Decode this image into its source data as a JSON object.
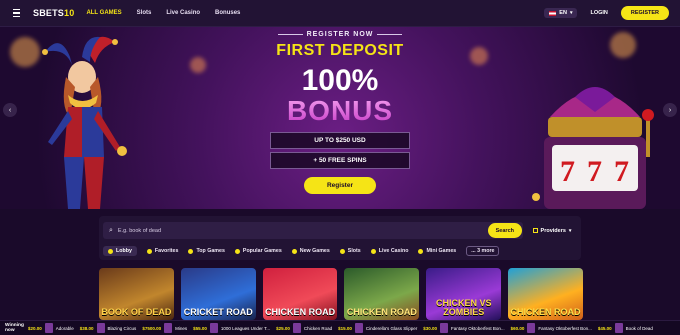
{
  "header": {
    "logo_main": "SBETS",
    "logo_accent": "10",
    "nav": [
      {
        "label": "ALL GAMES",
        "active": true
      },
      {
        "label": "Slots",
        "active": false
      },
      {
        "label": "Live Casino",
        "active": false
      },
      {
        "label": "Bonuses",
        "active": false
      }
    ],
    "language": "EN",
    "login_label": "LOGIN",
    "register_label": "REGISTER"
  },
  "hero": {
    "register_now": "REGISTER NOW",
    "first_deposit": "FIRST DEPOSIT",
    "percent": "100%",
    "bonus": "BONUS",
    "offer_1": "UP TO $250 USD",
    "offer_2": "+ 50 FREE SPINS",
    "cta_label": "Register",
    "prev_icon": "chevron-left-icon",
    "next_icon": "chevron-right-icon"
  },
  "search": {
    "placeholder": "E.g. book of dead",
    "button_label": "Search",
    "providers_label": "Providers"
  },
  "categories": [
    {
      "label": "Lobby",
      "active": true,
      "icon": "lobby-icon"
    },
    {
      "label": "Favorites",
      "active": false,
      "icon": "star-icon"
    },
    {
      "label": "Top Games",
      "active": false,
      "icon": "trophy-icon"
    },
    {
      "label": "Popular Games",
      "active": false,
      "icon": "fire-icon"
    },
    {
      "label": "New Games",
      "active": false,
      "icon": "new-icon"
    },
    {
      "label": "Slots",
      "active": false,
      "icon": "slots-icon"
    },
    {
      "label": "Live Casino",
      "active": false,
      "icon": "live-icon"
    },
    {
      "label": "Mini Games",
      "active": false,
      "icon": "mini-games-icon"
    },
    {
      "label": "... 3 more",
      "active": false,
      "icon": ""
    }
  ],
  "games": [
    {
      "title": "BOOK OF DEAD"
    },
    {
      "title": "CRICKET ROAD"
    },
    {
      "title": "CHICKEN ROAD"
    },
    {
      "title": "CHICKEN ROAD"
    },
    {
      "title": "CHICKEN VS ZOMBIES"
    },
    {
      "title": "CHICKEN ROAD"
    }
  ],
  "ticker": {
    "label_line1": "Winning",
    "label_line2": "now",
    "wins": [
      {
        "amount": "$20.00",
        "game": "Adorable"
      },
      {
        "amount": "$38.00",
        "game": "Blazing Circus"
      },
      {
        "amount": "$7500.00",
        "game": "Mines"
      },
      {
        "amount": "$55.00",
        "game": "1000 Leagues Under T..."
      },
      {
        "amount": "$25.00",
        "game": "Chicken Road"
      },
      {
        "amount": "$15.00",
        "game": "Cinderella's Glass Slipper"
      },
      {
        "amount": "$30.00",
        "game": "Fantasy Oktoberfest Bon..."
      },
      {
        "amount": "$60.00",
        "game": "Fantasy Oktoberfest Bon..."
      },
      {
        "amount": "$45.00",
        "game": "Book of Dead"
      }
    ]
  },
  "colors": {
    "accent": "#f5e416",
    "bonus_pink": "#d860d8",
    "background": "#1a0a2a",
    "panel": "#221334"
  }
}
